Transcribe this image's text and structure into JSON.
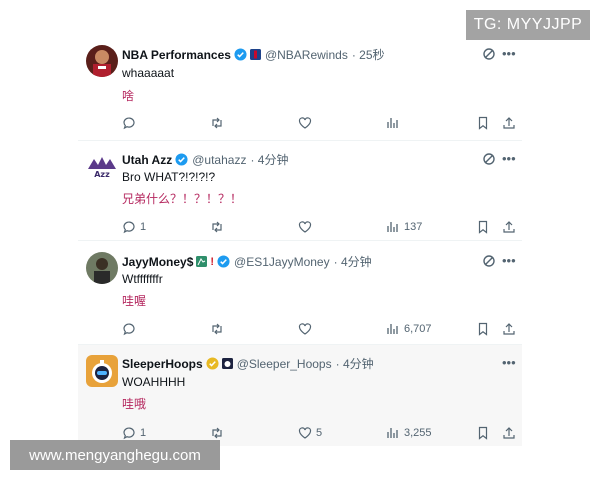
{
  "overlay": {
    "tg_label": "TG: MYYJJPP",
    "site_label": "www.mengyanghegu.com"
  },
  "tweets": [
    {
      "name": "NBA Performances",
      "handle": "@NBARewinds",
      "time": "· 25秒",
      "text": "whaaaaat",
      "translation": "啥",
      "replies": "",
      "retweets": "",
      "likes": "",
      "views": "",
      "verified_color": "#1d9bf0"
    },
    {
      "name": "Utah Azz",
      "handle": "@utahazz",
      "time": "· 4分钟",
      "text": "Bro WHAT?!?!?!?",
      "translation": "兄弟什么？！？！？！",
      "replies": "1",
      "retweets": "",
      "likes": "",
      "views": "137",
      "verified_color": "#1d9bf0"
    },
    {
      "name": "JayyMoney$",
      "handle": "@ES1JayyMoney",
      "time": "· 4分钟",
      "text": "Wtfffffffr",
      "translation": "哇喔",
      "replies": "",
      "retweets": "",
      "likes": "",
      "views": "6,707",
      "verified_color": "#1d9bf0"
    },
    {
      "name": "SleeperHoops",
      "handle": "@Sleeper_Hoops",
      "time": "· 4分钟",
      "text": "WOAHHHH",
      "translation": "哇哦",
      "replies": "1",
      "retweets": "",
      "likes": "5",
      "views": "3,255",
      "verified_color": "#e8b923"
    }
  ],
  "icons": {
    "reply": "reply-icon",
    "retweet": "retweet-icon",
    "like": "heart-icon",
    "views": "views-icon",
    "bookmark": "bookmark-icon",
    "share": "share-icon",
    "grok": "grok-icon",
    "more": "more-icon"
  }
}
